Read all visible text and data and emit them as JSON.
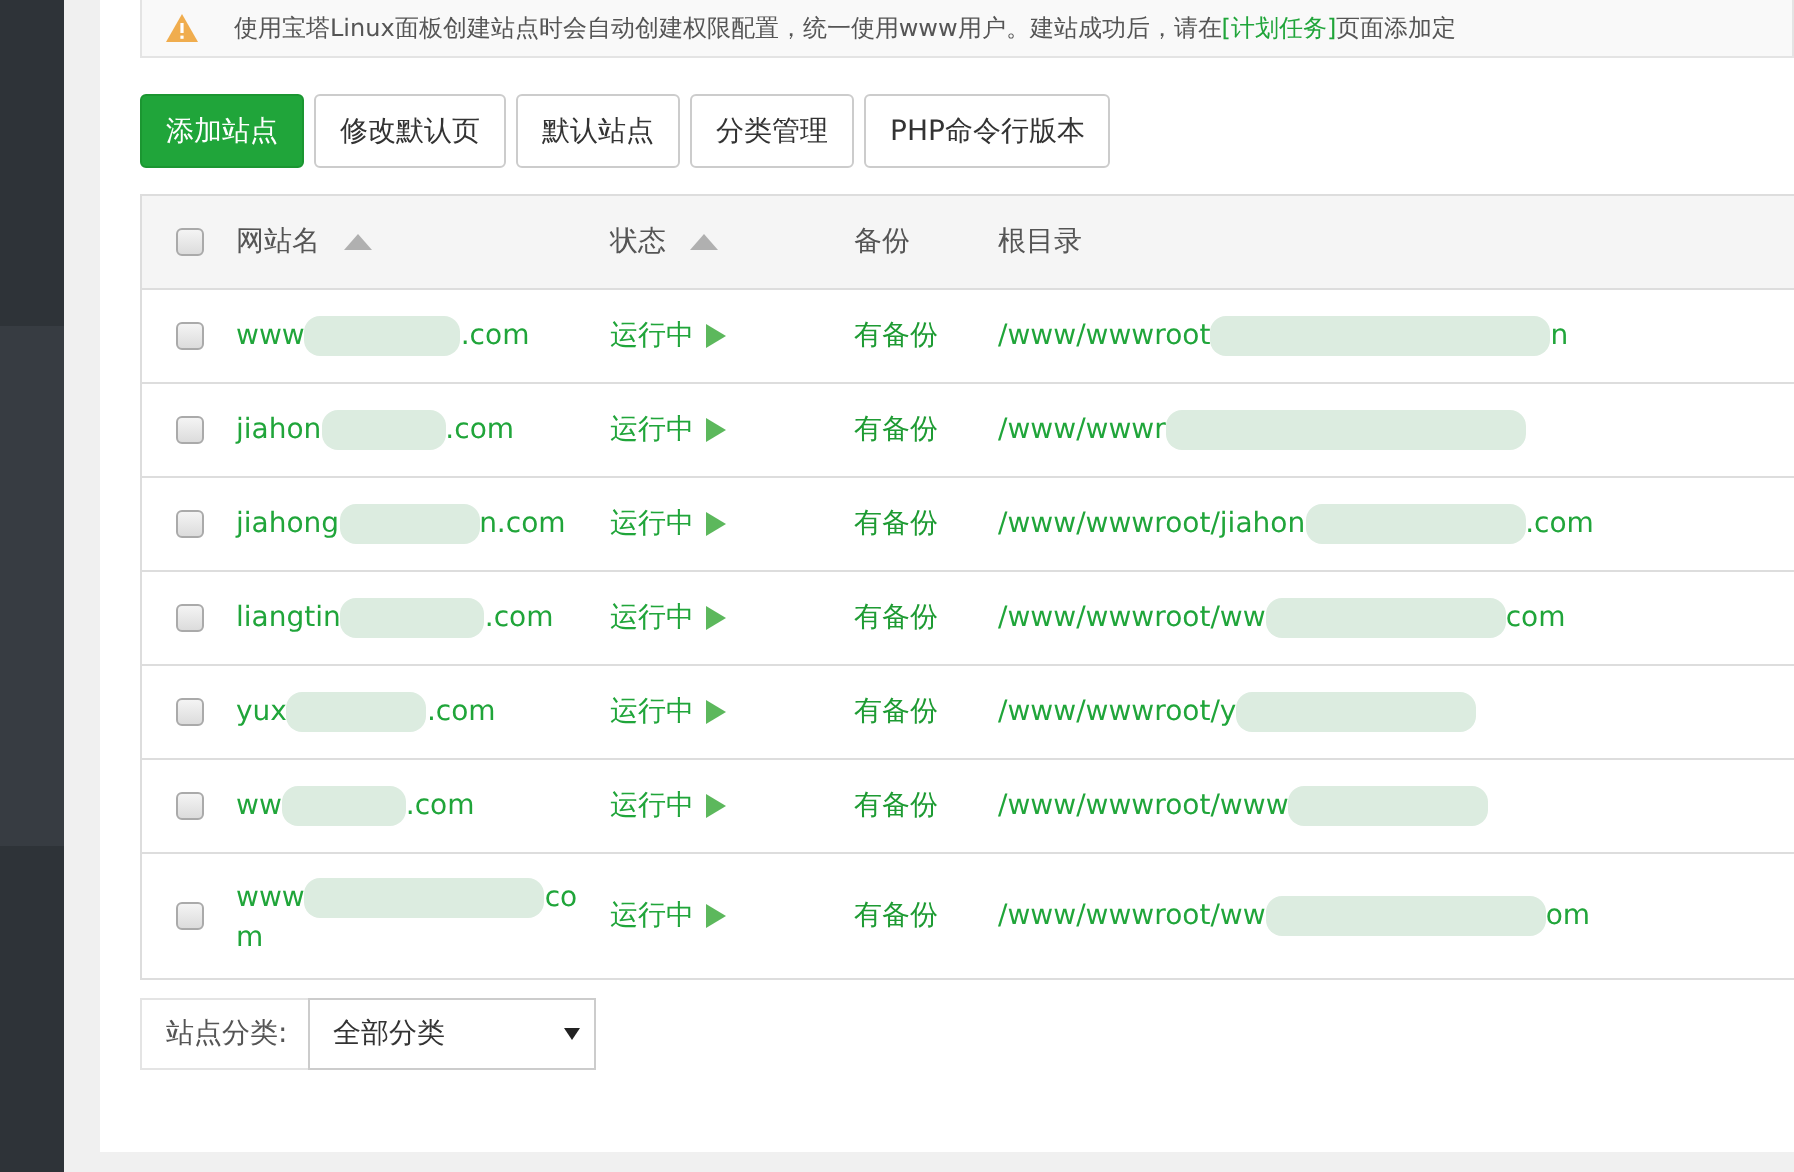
{
  "notice": {
    "text_before": "使用宝塔Linux面板创建站点时会自动创建权限配置，统一使用www用户。建站成功后，请在",
    "link": "[计划任务]",
    "text_after": "页面添加定"
  },
  "toolbar": [
    {
      "label": "添加站点",
      "kind": "primary"
    },
    {
      "label": "修改默认页",
      "kind": "default"
    },
    {
      "label": "默认站点",
      "kind": "default"
    },
    {
      "label": "分类管理",
      "kind": "default"
    },
    {
      "label": "PHP命令行版本",
      "kind": "default"
    }
  ],
  "table": {
    "select_all_checked": false,
    "columns": [
      {
        "label": "网站名",
        "sortable": true
      },
      {
        "label": "状态",
        "sortable": true
      },
      {
        "label": "备份",
        "sortable": false
      },
      {
        "label": "根目录",
        "sortable": false
      }
    ],
    "rows": [
      {
        "checked": false,
        "name_start": "www",
        "name_end": ".com",
        "status": "运行中",
        "running": true,
        "backup": "有备份",
        "path_start": "/www/wwwroot",
        "path_end": "n"
      },
      {
        "checked": false,
        "name_start": "jiahon",
        "name_end": ".com",
        "status": "运行中",
        "running": true,
        "backup": "有备份",
        "path_start": "/www/wwwr",
        "path_end": ""
      },
      {
        "checked": false,
        "name_start": "jiahong",
        "name_end": "n.com",
        "status": "运行中",
        "running": true,
        "backup": "有备份",
        "path_start": "/www/wwwroot/jiahon",
        "path_end": ".com"
      },
      {
        "checked": false,
        "name_start": "liangtin",
        "name_end": ".com",
        "status": "运行中",
        "running": true,
        "backup": "有备份",
        "path_start": "/www/wwwroot/ww",
        "path_end": "com"
      },
      {
        "checked": false,
        "name_start": "yux",
        "name_end": ".com",
        "status": "运行中",
        "running": true,
        "backup": "有备份",
        "path_start": "/www/wwwroot/y",
        "path_end": ""
      },
      {
        "checked": false,
        "name_start": "ww",
        "name_end": ".com",
        "status": "运行中",
        "running": true,
        "backup": "有备份",
        "path_start": "/www/wwwroot/www",
        "path_end": ""
      },
      {
        "checked": false,
        "name_start": "www",
        "name_end": "co",
        "name_wrap": "m",
        "status": "运行中",
        "running": true,
        "backup": "有备份",
        "path_start": "/www/wwwroot/ww",
        "path_end": "om"
      }
    ]
  },
  "filter": {
    "label": "站点分类:",
    "value": "全部分类"
  }
}
